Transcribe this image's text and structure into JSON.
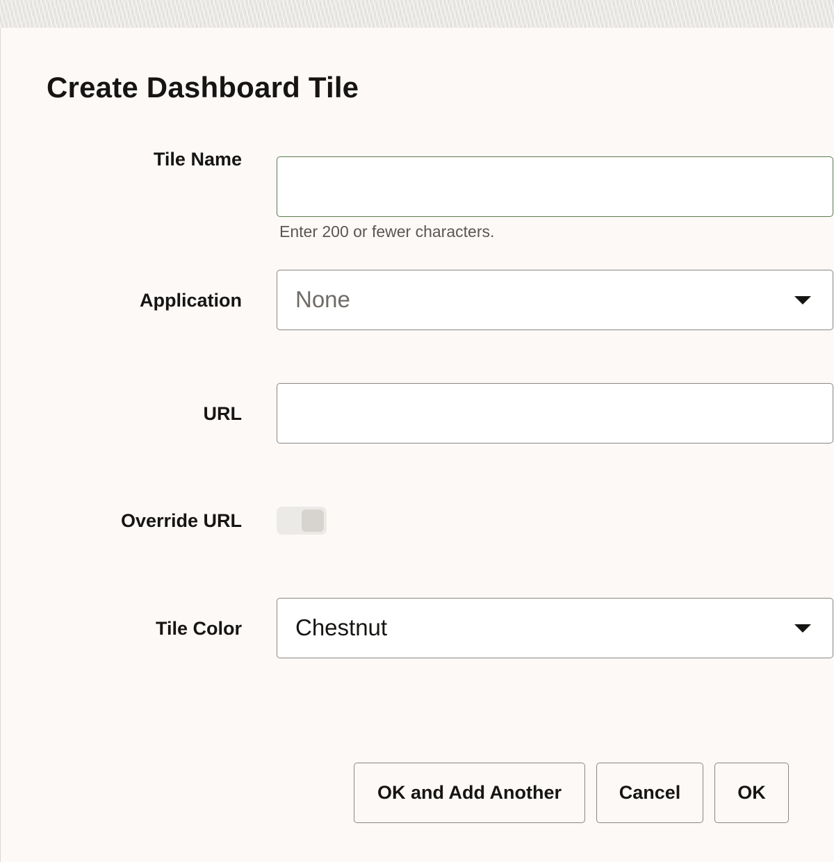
{
  "dialog": {
    "title": "Create Dashboard Tile"
  },
  "fields": {
    "tile_name": {
      "label": "Tile Name",
      "value": "",
      "helper": "Enter 200 or fewer characters."
    },
    "application": {
      "label": "Application",
      "selected": "None"
    },
    "url": {
      "label": "URL",
      "value": ""
    },
    "override_url": {
      "label": "Override URL",
      "enabled": false
    },
    "tile_color": {
      "label": "Tile Color",
      "selected": "Chestnut"
    }
  },
  "buttons": {
    "ok_and_add_another": "OK and Add Another",
    "cancel": "Cancel",
    "ok": "OK"
  },
  "colors": {
    "focus_border": "#5b7a4f",
    "border": "#8a8682",
    "background": "#fcf9f7"
  },
  "icons": {
    "dropdown": "chevron-down-icon"
  }
}
